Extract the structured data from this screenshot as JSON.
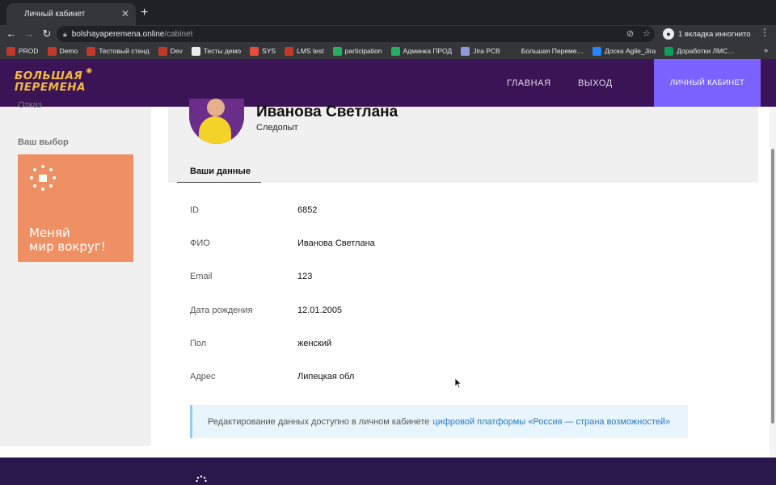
{
  "browser": {
    "tab_title": "Личный кабинет",
    "tab_close": "✕",
    "new_tab": "+",
    "url_host": "bolshayaperemena.online",
    "url_path": "/cabinet",
    "incognito_label": "1 вкладка инкогнито",
    "bookmarks_more": "»",
    "bookmarks": [
      {
        "label": "PROD",
        "color": "#c0392b"
      },
      {
        "label": "Demo",
        "color": "#c0392b"
      },
      {
        "label": "Тестовый стенд",
        "color": "#c0392b"
      },
      {
        "label": "Dev",
        "color": "#c0392b"
      },
      {
        "label": "Тесты демо",
        "color": "#e8eaed"
      },
      {
        "label": "SYS",
        "color": "#e74c3c"
      },
      {
        "label": "LMS test",
        "color": "#c0392b"
      },
      {
        "label": "participation",
        "color": "#27ae60"
      },
      {
        "label": "Админка ПРОД",
        "color": "#27ae60"
      },
      {
        "label": "Jira PCB",
        "color": "#8e9bd8"
      },
      {
        "label": "Большая Переме…",
        "color": "#35363a"
      },
      {
        "label": "Доска Agile_Jira",
        "color": "#2684ff"
      },
      {
        "label": "Доработки ЛМС…",
        "color": "#0f9d58"
      }
    ]
  },
  "header": {
    "logo_line1": "БОЛЬШАЯ",
    "logo_line2": "ПЕРЕМЕНА",
    "nav_home": "ГЛАВНАЯ",
    "nav_logout": "ВЫХОД",
    "cabinet_button": "ЛИЧНЫЙ КАБИНЕТ",
    "brand_color": "#3b1456",
    "accent_color": "#7b61ff"
  },
  "sidebar": {
    "cut_text": "Отказ",
    "choice_title": "Ваш выбор",
    "promo_text_line1": "Меняй",
    "promo_text_line2": "мир вокруг!",
    "promo_color": "#ee9064"
  },
  "profile": {
    "name": "Иванова Светлана",
    "role": "Следопыт",
    "tab_label": "Ваши данные",
    "fields": [
      {
        "label": "ID",
        "value": "6852"
      },
      {
        "label": "ФИО",
        "value": "Иванова Светлана"
      },
      {
        "label": "Email",
        "value": "123"
      },
      {
        "label": "Дата рождения",
        "value": "12.01.2005"
      },
      {
        "label": "Пол",
        "value": "женский"
      },
      {
        "label": "Адрес",
        "value": "Липецкая обл"
      }
    ]
  },
  "notice": {
    "text": "Редактирование данных доступно в личном кабинете",
    "link": "цифровой платформы «Россия — страна возможностей»"
  }
}
